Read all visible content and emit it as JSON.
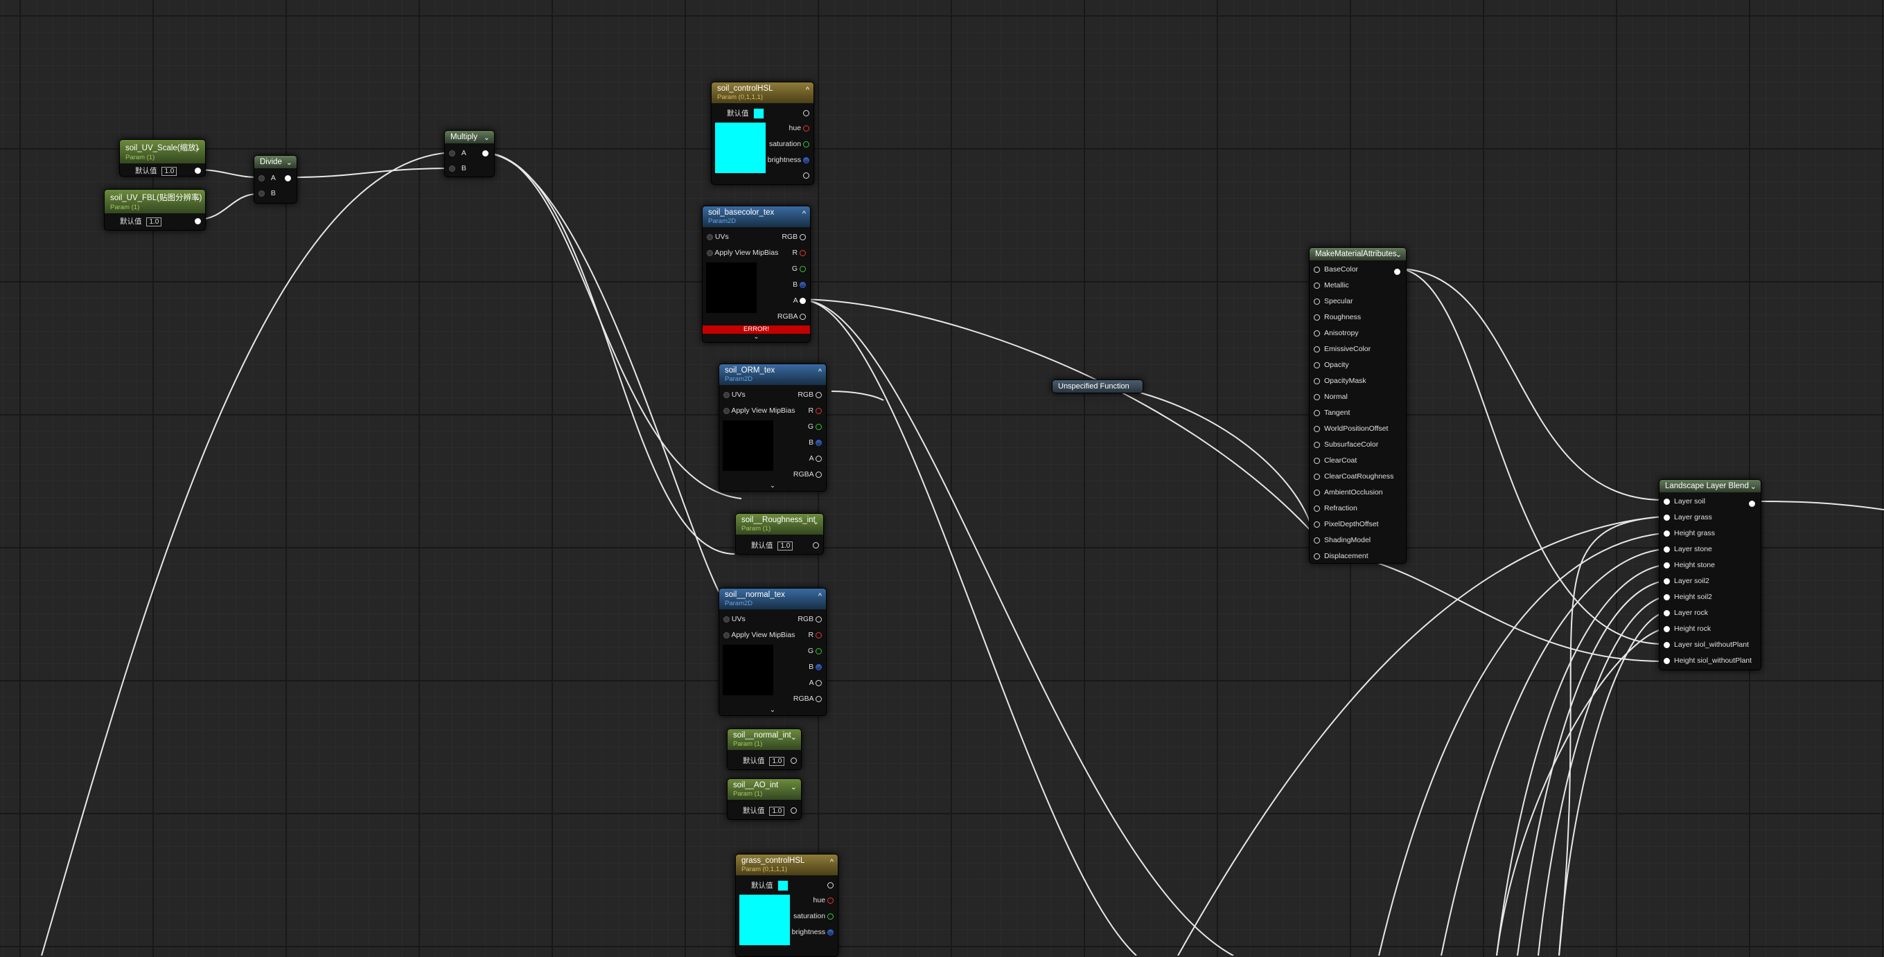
{
  "nodes": {
    "uv_scale": {
      "title": "soil_UV_Scale(缩放)",
      "sub": "Param (1)",
      "default_label": "默认值",
      "value": "1.0"
    },
    "uv_fbl": {
      "title": "soil_UV_FBL(贴图分辨率)",
      "sub": "Param (1)",
      "default_label": "默认值",
      "value": "1.0"
    },
    "divide": {
      "title": "Divide",
      "a": "A",
      "b": "B"
    },
    "multiply": {
      "title": "Multiply",
      "a": "A",
      "b": "B"
    },
    "soil_hsl": {
      "title": "soil_controlHSL",
      "sub": "Param (0,1,1,1)",
      "default_label": "默认值",
      "hue": "hue",
      "saturation": "saturation",
      "brightness": "brightness"
    },
    "soil_basecolor": {
      "title": "soil_basecolor_tex",
      "sub": "Param2D",
      "uvs": "UVs",
      "mip": "Apply View MipBias",
      "rgb": "RGB",
      "r": "R",
      "g": "G",
      "b": "B",
      "a": "A",
      "rgba": "RGBA",
      "error": "ERROR!"
    },
    "soil_orm": {
      "title": "soil_ORM_tex",
      "sub": "Param2D",
      "uvs": "UVs",
      "mip": "Apply View MipBias",
      "rgb": "RGB",
      "r": "R",
      "g": "G",
      "b": "B",
      "a": "A",
      "rgba": "RGBA"
    },
    "soil_rough": {
      "title": "soil__Roughness_int",
      "sub": "Param (1)",
      "default_label": "默认值",
      "value": "1.0"
    },
    "soil_normal": {
      "title": "soil__normal_tex",
      "sub": "Param2D",
      "uvs": "UVs",
      "mip": "Apply View MipBias",
      "rgb": "RGB",
      "r": "R",
      "g": "G",
      "b": "B",
      "a": "A",
      "rgba": "RGBA"
    },
    "soil_normal_int": {
      "title": "soil__normal_int",
      "sub": "Param (1)",
      "default_label": "默认值",
      "value": "1.0"
    },
    "soil_ao": {
      "title": "soil__AO_int",
      "sub": "Param (1)",
      "default_label": "默认值",
      "value": "1.0"
    },
    "grass_hsl": {
      "title": "grass_controlHSL",
      "sub": "Param (0,1,1,1)",
      "default_label": "默认值",
      "hue": "hue",
      "saturation": "saturation",
      "brightness": "brightness"
    },
    "unspecified": {
      "title": "Unspecified Function"
    },
    "mma": {
      "title": "MakeMaterialAttributes",
      "pins": [
        "BaseColor",
        "Metallic",
        "Specular",
        "Roughness",
        "Anisotropy",
        "EmissiveColor",
        "Opacity",
        "OpacityMask",
        "Normal",
        "Tangent",
        "WorldPositionOffset",
        "SubsurfaceColor",
        "ClearCoat",
        "ClearCoatRoughness",
        "AmbientOcclusion",
        "Refraction",
        "PixelDepthOffset",
        "ShadingModel",
        "Displacement"
      ]
    },
    "llb": {
      "title": "Landscape Layer Blend",
      "pins": [
        "Layer soil",
        "Layer grass",
        "Height grass",
        "Layer stone",
        "Height stone",
        "Layer soil2",
        "Height soil2",
        "Layer rock",
        "Height rock",
        "Layer siol_withoutPlant",
        "Height siol_withoutPlant"
      ]
    }
  },
  "colors": {
    "swatch": "#00ffff",
    "error": "#c40000"
  }
}
